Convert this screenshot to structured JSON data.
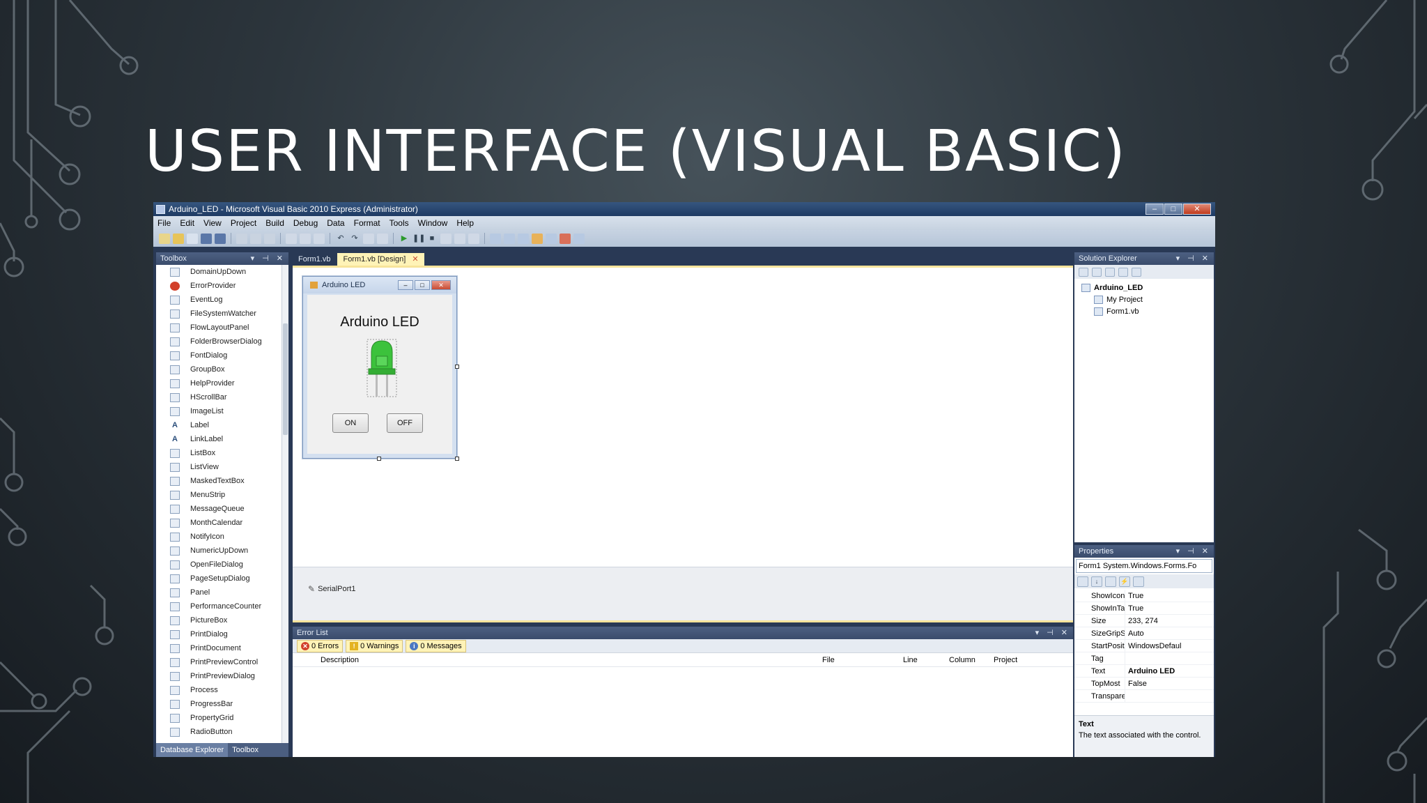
{
  "slide": {
    "title": "USER INTERFACE (VISUAL BASIC)"
  },
  "window": {
    "title": "Arduino_LED - Microsoft Visual Basic 2010 Express (Administrator)",
    "minimize": "–",
    "maximize": "□",
    "close": "✕"
  },
  "menu": [
    "File",
    "Edit",
    "View",
    "Project",
    "Build",
    "Debug",
    "Data",
    "Format",
    "Tools",
    "Window",
    "Help"
  ],
  "toolbox": {
    "header": "Toolbox",
    "items": [
      {
        "label": "DomainUpDown",
        "icon": "domainupdown-icon"
      },
      {
        "label": "ErrorProvider",
        "icon": "error-provider-icon"
      },
      {
        "label": "EventLog",
        "icon": "eventlog-icon"
      },
      {
        "label": "FileSystemWatcher",
        "icon": "filesystemwatcher-icon"
      },
      {
        "label": "FlowLayoutPanel",
        "icon": "flowlayoutpanel-icon"
      },
      {
        "label": "FolderBrowserDialog",
        "icon": "folderbrowserdialog-icon"
      },
      {
        "label": "FontDialog",
        "icon": "fontdialog-icon"
      },
      {
        "label": "GroupBox",
        "icon": "groupbox-icon"
      },
      {
        "label": "HelpProvider",
        "icon": "helpprovider-icon"
      },
      {
        "label": "HScrollBar",
        "icon": "hscrollbar-icon"
      },
      {
        "label": "ImageList",
        "icon": "imagelist-icon"
      },
      {
        "label": "Label",
        "icon": "label-icon"
      },
      {
        "label": "LinkLabel",
        "icon": "linklabel-icon"
      },
      {
        "label": "ListBox",
        "icon": "listbox-icon"
      },
      {
        "label": "ListView",
        "icon": "listview-icon"
      },
      {
        "label": "MaskedTextBox",
        "icon": "maskedtextbox-icon"
      },
      {
        "label": "MenuStrip",
        "icon": "menustrip-icon"
      },
      {
        "label": "MessageQueue",
        "icon": "messagequeue-icon"
      },
      {
        "label": "MonthCalendar",
        "icon": "monthcalendar-icon"
      },
      {
        "label": "NotifyIcon",
        "icon": "notifyicon-icon"
      },
      {
        "label": "NumericUpDown",
        "icon": "numericupdown-icon"
      },
      {
        "label": "OpenFileDialog",
        "icon": "openfiledialog-icon"
      },
      {
        "label": "PageSetupDialog",
        "icon": "pagesetupdialog-icon"
      },
      {
        "label": "Panel",
        "icon": "panel-icon"
      },
      {
        "label": "PerformanceCounter",
        "icon": "performancecounter-icon"
      },
      {
        "label": "PictureBox",
        "icon": "picturebox-icon"
      },
      {
        "label": "PrintDialog",
        "icon": "printdialog-icon"
      },
      {
        "label": "PrintDocument",
        "icon": "printdocument-icon"
      },
      {
        "label": "PrintPreviewControl",
        "icon": "printpreviewcontrol-icon"
      },
      {
        "label": "PrintPreviewDialog",
        "icon": "printpreviewdialog-icon"
      },
      {
        "label": "Process",
        "icon": "process-icon"
      },
      {
        "label": "ProgressBar",
        "icon": "progressbar-icon"
      },
      {
        "label": "PropertyGrid",
        "icon": "propertygrid-icon"
      },
      {
        "label": "RadioButton",
        "icon": "radiobutton-icon"
      }
    ],
    "footer_tabs": [
      "Database Explorer",
      "Toolbox"
    ]
  },
  "doc_tabs": [
    {
      "label": "Form1.vb",
      "active": false
    },
    {
      "label": "Form1.vb [Design]",
      "active": true
    }
  ],
  "form": {
    "title": "Arduino LED",
    "heading": "Arduino LED",
    "on_label": "ON",
    "off_label": "OFF",
    "led_color": "#3cc23c"
  },
  "component_tray": {
    "item": "SerialPort1"
  },
  "error_list": {
    "header": "Error List",
    "errors": "0 Errors",
    "warnings": "0 Warnings",
    "messages": "0 Messages",
    "columns": [
      "Description",
      "File",
      "Line",
      "Column",
      "Project"
    ]
  },
  "solution_explorer": {
    "header": "Solution Explorer",
    "project": "Arduino_LED",
    "children": [
      "My Project",
      "Form1.vb"
    ]
  },
  "properties": {
    "header": "Properties",
    "object": "Form1 System.Windows.Forms.Fo",
    "rows": [
      {
        "name": "ShowIcon",
        "value": "True"
      },
      {
        "name": "ShowInTaskb",
        "value": "True"
      },
      {
        "name": "Size",
        "value": "233, 274"
      },
      {
        "name": "SizeGripStyle",
        "value": "Auto"
      },
      {
        "name": "StartPosition",
        "value": "WindowsDefaul"
      },
      {
        "name": "Tag",
        "value": ""
      },
      {
        "name": "Text",
        "value": "Arduino LED"
      },
      {
        "name": "TopMost",
        "value": "False"
      },
      {
        "name": "Transparency",
        "value": ""
      }
    ],
    "desc_title": "Text",
    "desc_text": "The text associated with the control."
  }
}
